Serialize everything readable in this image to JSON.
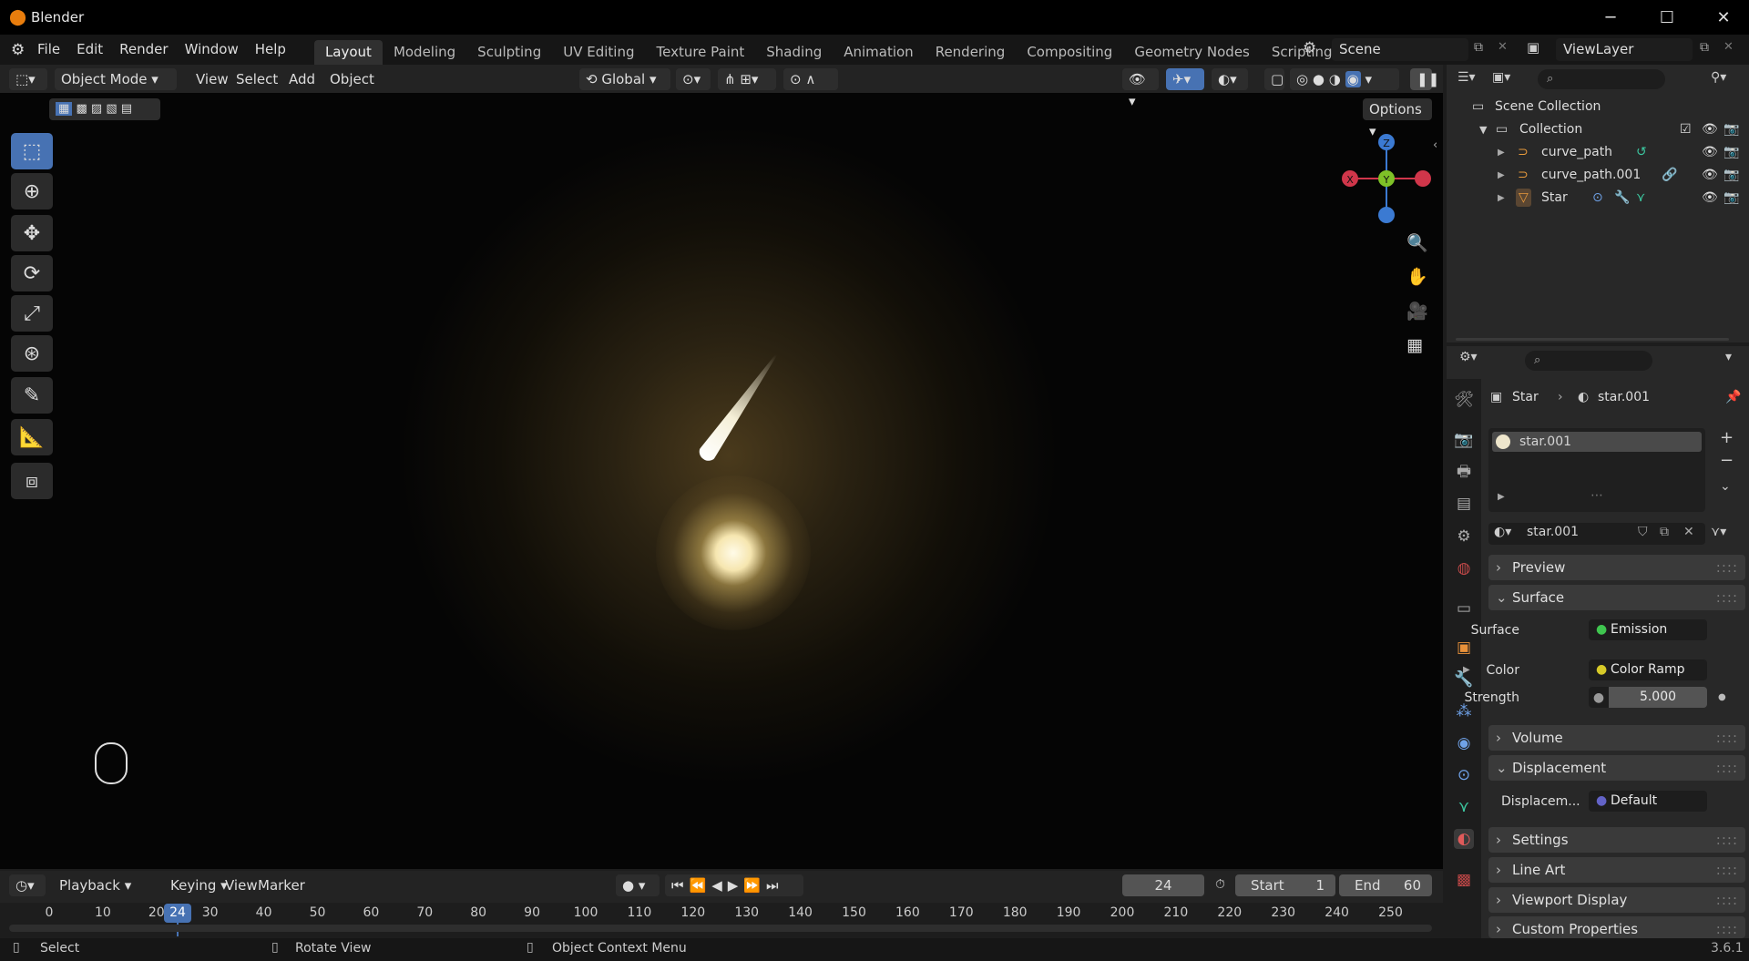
{
  "window": {
    "title": "Blender",
    "minimize": "─",
    "maximize": "☐",
    "close": "✕"
  },
  "menu": [
    "File",
    "Edit",
    "Render",
    "Window",
    "Help"
  ],
  "workspaces": [
    "Layout",
    "Modeling",
    "Sculpting",
    "UV Editing",
    "Texture Paint",
    "Shading",
    "Animation",
    "Rendering",
    "Compositing",
    "Geometry Nodes",
    "Scripting"
  ],
  "active_workspace": "Layout",
  "add_workspace": "+",
  "scene": {
    "name": "Scene",
    "view_layer": "ViewLayer"
  },
  "viewport_header": {
    "mode": "Object Mode",
    "menus": [
      "View",
      "Select",
      "Add",
      "Object"
    ],
    "transform_orientation": "Global",
    "options": "Options"
  },
  "gizmo": {
    "x": "X",
    "y": "Y",
    "z": "Z"
  },
  "outliner": {
    "root": "Scene Collection",
    "collection": "Collection",
    "items": [
      "curve_path",
      "curve_path.001",
      "Star"
    ]
  },
  "properties": {
    "breadcrumb_object": "Star",
    "breadcrumb_material": "star.001",
    "slot": "star.001",
    "material_name": "star.001",
    "panels": {
      "preview": "Preview",
      "surface": "Surface",
      "volume": "Volume",
      "displacement": "Displacement",
      "settings": "Settings",
      "line_art": "Line Art",
      "viewport_display": "Viewport Display",
      "custom_properties": "Custom Properties"
    },
    "surface_label": "Surface",
    "surface_value": "Emission",
    "color_label": "Color",
    "color_value": "Color Ramp",
    "strength_label": "Strength",
    "strength_value": "5.000",
    "displacement_label": "Displacem...",
    "displacement_value": "Default"
  },
  "timeline": {
    "menus": [
      "Playback",
      "Keying",
      "View",
      "Marker"
    ],
    "current_frame": "24",
    "start_label": "Start",
    "start": "1",
    "end_label": "End",
    "end": "60",
    "ticks": [
      "0",
      "10",
      "20",
      "30",
      "40",
      "50",
      "60",
      "70",
      "80",
      "90",
      "100",
      "110",
      "120",
      "130",
      "140",
      "150",
      "160",
      "170",
      "180",
      "190",
      "200",
      "210",
      "220",
      "230",
      "240",
      "250"
    ],
    "playhead": "24"
  },
  "status": {
    "select": "Select",
    "rotate": "Rotate View",
    "context": "Object Context Menu",
    "version": "3.6.1"
  },
  "colors": {
    "accent": "#4772b3",
    "x_axis": "#d0364a",
    "y_axis": "#7ec127",
    "z_axis": "#3b7ad2"
  }
}
